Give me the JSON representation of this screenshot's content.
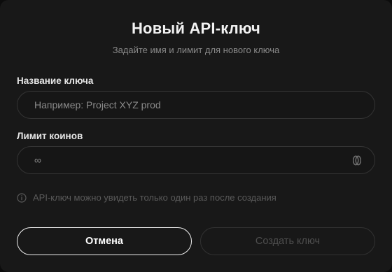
{
  "dialog": {
    "title": "Новый API-ключ",
    "subtitle": "Задайте имя и лимит для нового ключа"
  },
  "fields": {
    "name": {
      "label": "Название ключа",
      "placeholder": "Например: Project XYZ prod"
    },
    "limit": {
      "label": "Лимит коинов",
      "value": "∞",
      "icon": "coin-icon"
    }
  },
  "hint": {
    "icon": "info-icon",
    "text": "API-ключ можно увидеть только один раз после создания"
  },
  "buttons": {
    "cancel_label": "Отмена",
    "create_label": "Создать ключ",
    "create_disabled": true
  },
  "colors": {
    "background": "#181818",
    "text_primary": "#f2f2f2",
    "text_muted": "#8a8a8a",
    "border": "#343434"
  }
}
